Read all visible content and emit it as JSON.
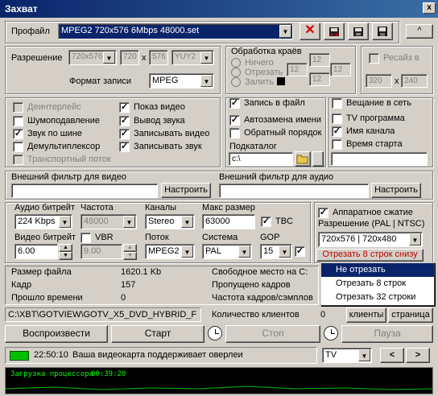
{
  "window": {
    "title": "Захват",
    "close": "x"
  },
  "profile": {
    "label": "Профайл",
    "value": "MPEG2 720x576 6Mbps 48000.set",
    "up": "^"
  },
  "resolution": {
    "label": "Разрешение",
    "w_combo": "720x576",
    "w": "720",
    "x": "x",
    "h": "576",
    "fmt": "YUY2"
  },
  "format": {
    "label": "Формат записи",
    "value": "MPEG"
  },
  "edges": {
    "title": "Обработка краёв",
    "opt1": "Ничего",
    "opt2": "Отрезать",
    "opt3": "Залить",
    "v1": "12",
    "v2": "12",
    "v3": "12",
    "v4": "12"
  },
  "resize": {
    "label": "Ресайз в",
    "w": "320",
    "x": "x",
    "h": "240"
  },
  "checks_left": [
    "Деинтерлейс",
    "Шумоподавление",
    "Звук по шине",
    "Демультиплексор",
    "Транспортный поток"
  ],
  "checks_mid": [
    "Показ видео",
    "Вывод звука",
    "Записывать видео",
    "Записывать звук"
  ],
  "record_file": "Запись в файл",
  "autoname": "Автозамена имени",
  "reverse": "Обратный порядок",
  "subdir": {
    "label": "Подкаталог",
    "value": "c:\\"
  },
  "broadcast": "Вещание в сеть",
  "tv_program": "TV программа",
  "channel_name": "Имя канала",
  "start_time": "Время старта",
  "filters": {
    "video_label": "Внешний фильтр для видео",
    "audio_label": "Внешний фильтр для аудио",
    "configure": "Настроить"
  },
  "audio": {
    "bitrate_label": "Аудио битрейт",
    "bitrate": "224 Kbps",
    "freq_label": "Частота",
    "freq": "48000",
    "channels_label": "Каналы",
    "channels": "Stereo",
    "maxsize_label": "Макс размер",
    "maxsize": "63000",
    "tbc": "TBC"
  },
  "video": {
    "bitrate_label": "Видео битрейт",
    "bitrate": "6.00",
    "vbr": "VBR",
    "vbr_val": "9.00",
    "stream_label": "Поток",
    "stream": "MPEG2",
    "system_label": "Система",
    "system": "PAL",
    "gop_label": "GOP",
    "gop": "15"
  },
  "hw": {
    "label": "Аппаратное сжатие",
    "res_label": "Разрешение (PAL | NTSC)",
    "res": "720x576 | 720x480",
    "cut": "Отрезать 8 строк снизу"
  },
  "dropdown": [
    "Не отрезать",
    "Отрезать 8 строк",
    "Отрезать 32 строки"
  ],
  "stats": {
    "size_label": "Размер файла",
    "size": "1620.1 Kb",
    "frame_label": "Кадр",
    "frame": "157",
    "elapsed_label": "Прошло времени",
    "elapsed": "0",
    "free_label": "Свободное место на С:",
    "skipped_label": "Пропущено кадров",
    "rate_label": "Частота кадров/сэмплов",
    "clients_label": "Количество клиентов",
    "clients": "0"
  },
  "path": "C:\\XBT\\GOTVIEW\\GOTV_X5_DVD_HYBRID_F",
  "clients_btn": "клиенты",
  "page_btn": "страница",
  "play": "Воспроизвести",
  "start": "Старт",
  "stop": "Стоп",
  "pause": "Пауза",
  "status": {
    "time": "22:50:10",
    "text": "Ваша видеокарта поддерживает оверлеи",
    "mode": "TV",
    "prev": "<",
    "next": ">"
  },
  "cpu": {
    "label": "Загрузка процессора",
    "time": "00:39:20"
  },
  "colors": {
    "title": "#0a246a",
    "highlight": "#0a246a",
    "cut_text": "#c00000",
    "status_green": "#00c000",
    "cpu_bg": "#000000",
    "cpu_text": "#00ff00"
  }
}
